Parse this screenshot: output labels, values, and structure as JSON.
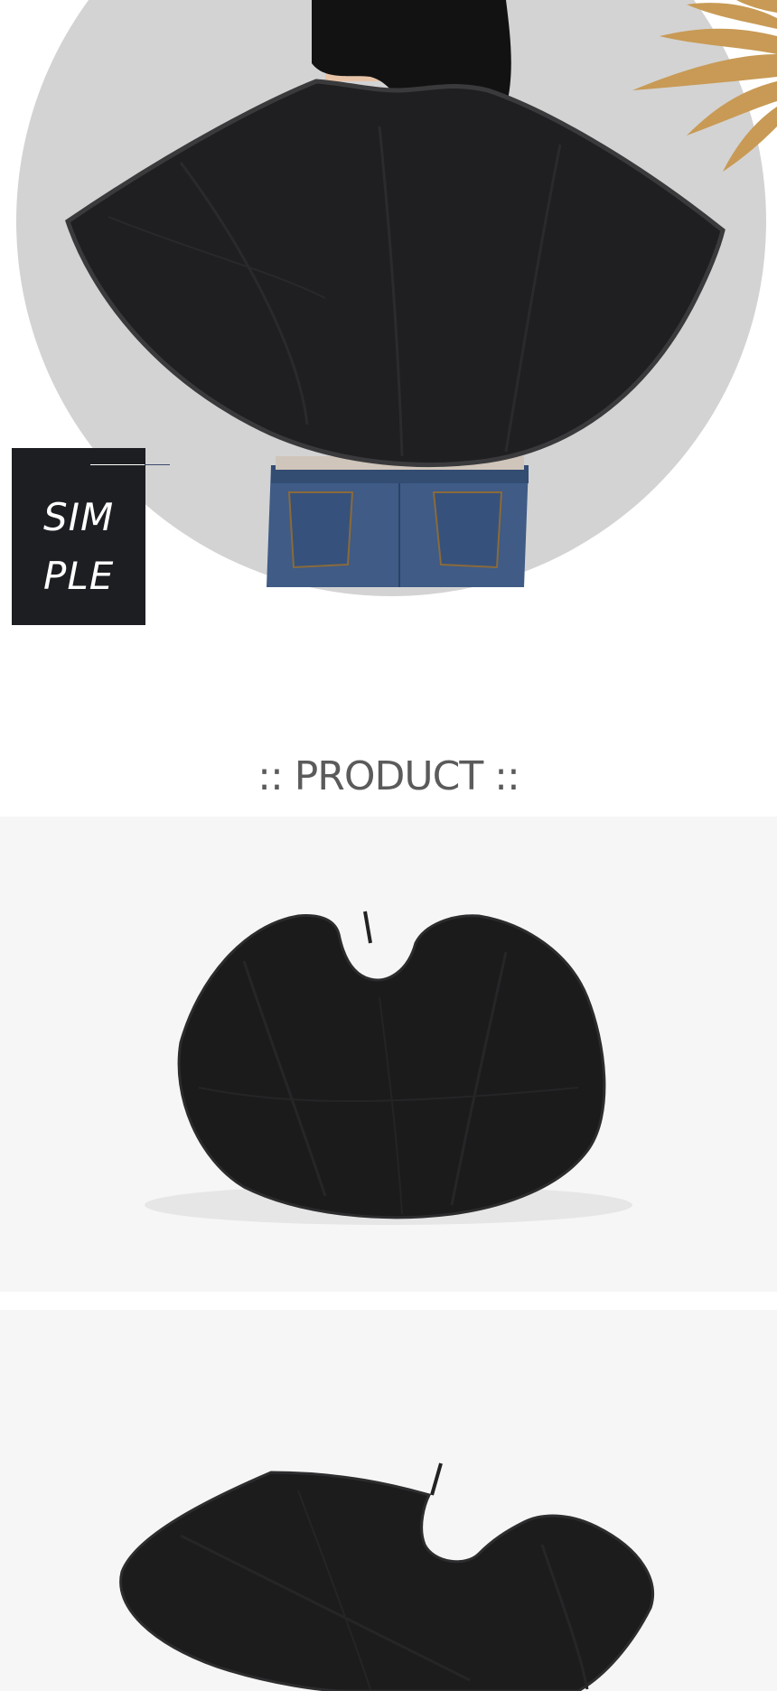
{
  "hero": {
    "badge": {
      "line1": "SIM",
      "line2": "PLE"
    }
  },
  "product_section": {
    "heading": ":: PRODUCT ::"
  },
  "colors": {
    "circle": "#d3d3d3",
    "badge": "#1d1e22",
    "cape": "#1f1f21",
    "panel": "#f6f6f6",
    "leaf": "#c89a55"
  },
  "icons": [
    "palm-leaf-icon"
  ]
}
